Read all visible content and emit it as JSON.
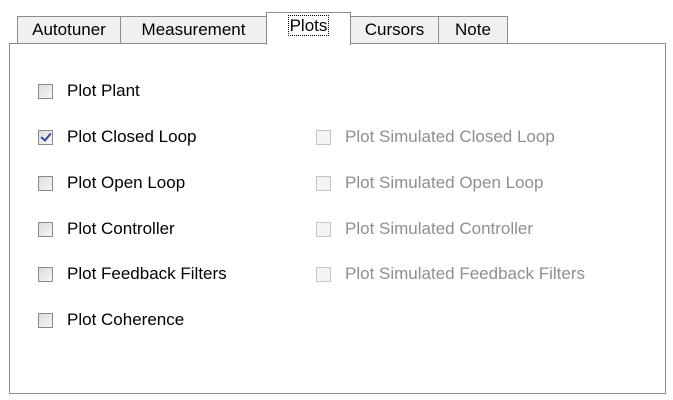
{
  "tabs": [
    {
      "label": "Autotuner"
    },
    {
      "label": "Measurement"
    },
    {
      "label": "Plots"
    },
    {
      "label": "Cursors"
    },
    {
      "label": "Note"
    }
  ],
  "active_tab": "Plots",
  "options_left": [
    {
      "label": "Plot Plant",
      "checked": false
    },
    {
      "label": "Plot Closed Loop",
      "checked": true
    },
    {
      "label": "Plot Open Loop",
      "checked": false
    },
    {
      "label": "Plot Controller",
      "checked": false
    },
    {
      "label": "Plot Feedback Filters",
      "checked": false
    },
    {
      "label": "Plot Coherence",
      "checked": false
    }
  ],
  "options_right": [
    {
      "label": "Plot Simulated Closed Loop",
      "checked": false,
      "enabled": false
    },
    {
      "label": "Plot Simulated Open Loop",
      "checked": false,
      "enabled": false
    },
    {
      "label": "Plot Simulated Controller",
      "checked": false,
      "enabled": false
    },
    {
      "label": "Plot Simulated Feedback Filters",
      "checked": false,
      "enabled": false
    }
  ],
  "colors": {
    "border": "#8c8c8c",
    "inactive_tab_bg": "#f0f0f0",
    "disabled_text": "#8f8f8f",
    "check_mark": "#2b4f9c"
  }
}
